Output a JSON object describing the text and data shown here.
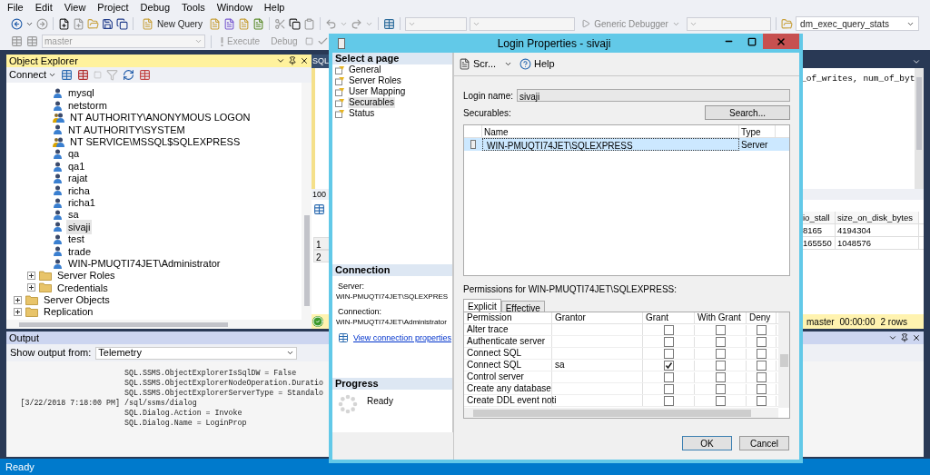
{
  "menu": [
    "File",
    "Edit",
    "View",
    "Project",
    "Debug",
    "Tools",
    "Window",
    "Help"
  ],
  "toolbar": {
    "new_query": "New Query",
    "debugger": "Generic Debugger",
    "query_name": "dm_exec_query_stats",
    "database": "master",
    "execute": "Execute",
    "debug": "Debug"
  },
  "object_explorer": {
    "title": "Object Explorer",
    "connect": "Connect",
    "tree": [
      {
        "children": [
          {
            "children": [
              {
                "label": "mysql",
                "kind": "user",
                "selected": false
              },
              {
                "label": "netstorm",
                "kind": "user",
                "selected": false
              },
              {
                "label": "NT AUTHORITY\\ANONYMOUS LOGON",
                "kind": "group",
                "selected": false
              },
              {
                "label": "NT AUTHORITY\\SYSTEM",
                "kind": "user",
                "selected": false
              },
              {
                "label": "NT SERVICE\\MSSQL$SQLEXPRESS",
                "kind": "group",
                "selected": false
              },
              {
                "label": "qa",
                "kind": "user",
                "selected": false
              },
              {
                "label": "qa1",
                "kind": "user",
                "selected": false
              },
              {
                "label": "rajat",
                "kind": "user",
                "selected": false
              },
              {
                "label": "richa",
                "kind": "user",
                "selected": false
              },
              {
                "label": "richa1",
                "kind": "user",
                "selected": false
              },
              {
                "label": "sa",
                "kind": "user",
                "selected": false
              },
              {
                "label": "sivaji",
                "kind": "user",
                "selected": true
              },
              {
                "label": "test",
                "kind": "user",
                "selected": false
              },
              {
                "label": "trade",
                "kind": "user",
                "selected": false
              },
              {
                "label": "WIN-PMUQTI74JET\\Administrator",
                "kind": "user",
                "selected": false
              }
            ]
          },
          {
            "label": "Server Roles",
            "kind": "folder",
            "expanded": false
          },
          {
            "label": "Credentials",
            "kind": "folder",
            "expanded": false
          }
        ]
      },
      {
        "label": "Server Objects",
        "kind": "folder",
        "expanded": false
      },
      {
        "label": "Replication",
        "kind": "folder",
        "expanded": false
      }
    ]
  },
  "query_window": {
    "tab": "SQL",
    "zoom": "100",
    "code": "_of_writes, num_of_byt",
    "columns": [
      "io_stall",
      "size_on_disk_bytes"
    ],
    "rows": [
      {
        "number": "1",
        "cells": [
          "8165",
          "4194304"
        ]
      },
      {
        "number": "2",
        "cells": [
          "165550",
          "1048576"
        ]
      }
    ],
    "status": {
      "database": "master",
      "elapsed": "00:00:00",
      "rows": "2 rows"
    }
  },
  "output": {
    "title": "Output",
    "source_label": "Show output from:",
    "source": "Telemetry",
    "lines": [
      {
        "text": "SQL.SSMS.ObjectExplorerIsSqlDW = False"
      },
      {
        "text": "SQL.SSMS.ObjectExplorerNodeOperation.Duratio"
      },
      {
        "text": "SQL.SSMS.ObjectExplorerServerType = Standalo"
      },
      {
        "time": "[3/22/2018 7:18:00 PM]",
        "text": "/sql/ssms/dialog"
      },
      {
        "text": "SQL.Dialog.Action = Invoke"
      },
      {
        "text": "SQL.Dialog.Name = LoginProp"
      }
    ]
  },
  "status_bar": "Ready",
  "dialog": {
    "title": "Login Properties - sivaji",
    "select_page_title": "Select a page",
    "pages": [
      {
        "label": "General",
        "selected": false
      },
      {
        "label": "Server Roles",
        "selected": false
      },
      {
        "label": "User Mapping",
        "selected": false
      },
      {
        "label": "Securables",
        "selected": true
      },
      {
        "label": "Status",
        "selected": false
      }
    ],
    "connection": {
      "title": "Connection",
      "server_label": "Server:",
      "server": "WIN-PMUQTI74JET\\SQLEXPRES",
      "connection_label": "Connection:",
      "connection": "WIN-PMUQTI74JET\\Administrator",
      "link": "View connection properties"
    },
    "progress": {
      "title": "Progress",
      "status": "Ready"
    },
    "toolbar": {
      "script": "Scr...",
      "help": "Help"
    },
    "login_name_label": "Login name:",
    "login_name": "sivaji",
    "securables_label": "Securables:",
    "search_button": "Search...",
    "securables": {
      "columns": [
        "Name",
        "Type"
      ],
      "rows": [
        {
          "name": "WIN-PMUQTI74JET\\SQLEXPRESS",
          "type": "Server",
          "selected": true
        }
      ]
    },
    "permissions_label": "Permissions for WIN-PMUQTI74JET\\SQLEXPRESS:",
    "tabs": [
      {
        "label": "Explicit",
        "selected": true
      },
      {
        "label": "Effective",
        "selected": false
      }
    ],
    "permissions": {
      "columns": [
        "Permission",
        "Grantor",
        "Grant",
        "With Grant",
        "Deny"
      ],
      "rows": [
        {
          "permission": "Alter trace",
          "grant": false,
          "with_grant": false,
          "deny": false
        },
        {
          "permission": "Authenticate server",
          "grant": false,
          "with_grant": false,
          "deny": false
        },
        {
          "permission": "Connect SQL",
          "grant": false,
          "with_grant": false,
          "deny": false
        },
        {
          "permission": "Connect SQL",
          "grantor": "sa",
          "grant": true,
          "with_grant": false,
          "deny": false
        },
        {
          "permission": "Control server",
          "grant": false,
          "with_grant": false,
          "deny": false
        },
        {
          "permission": "Create any database",
          "grant": false,
          "with_grant": false,
          "deny": false
        },
        {
          "permission": "Create DDL event noti",
          "grant": false,
          "with_grant": false,
          "deny": false
        }
      ]
    },
    "buttons": [
      "OK",
      "Cancel"
    ]
  }
}
